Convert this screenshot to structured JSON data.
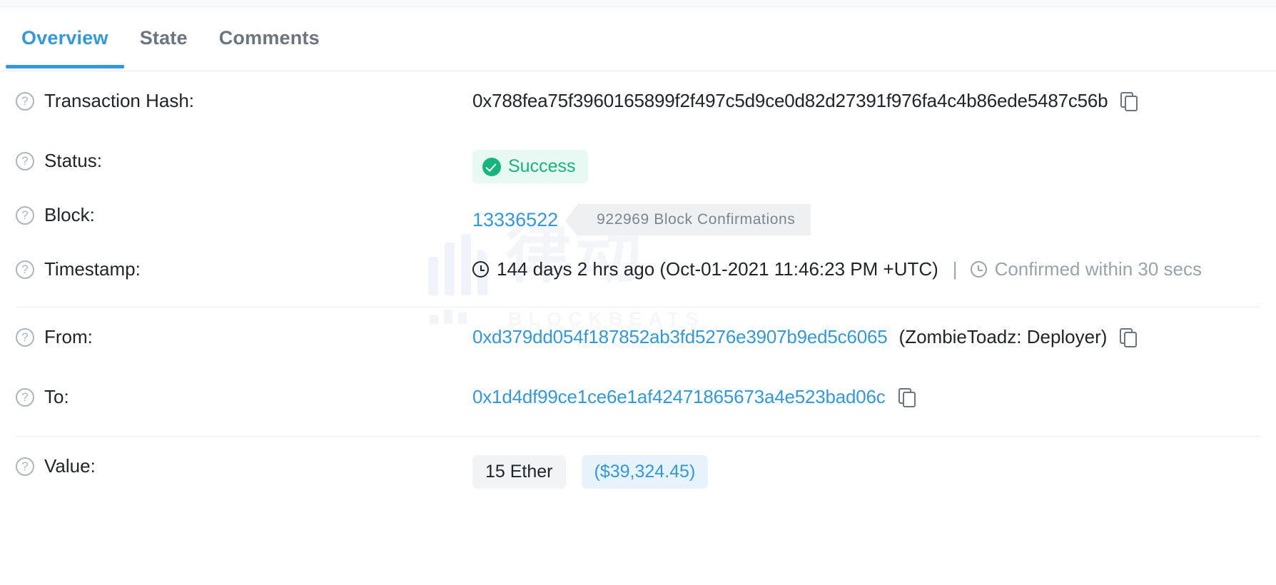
{
  "tabs": [
    {
      "label": "Overview",
      "active": true
    },
    {
      "label": "State",
      "active": false
    },
    {
      "label": "Comments",
      "active": false
    }
  ],
  "watermark": {
    "cjk": "律动",
    "word": "BLOCKBEATS"
  },
  "help_glyph": "?",
  "rows": {
    "transaction_hash": {
      "label": "Transaction Hash:",
      "value": "0x788fea75f3960165899f2f497c5d9ce0d82d27391f976fa4c4b86ede5487c56b"
    },
    "status": {
      "label": "Status:",
      "badge": "Success"
    },
    "block": {
      "label": "Block:",
      "number": "13336522",
      "confirmations": "922969 Block Confirmations"
    },
    "timestamp": {
      "label": "Timestamp:",
      "relative": "144 days 2 hrs ago (Oct-01-2021 11:46:23 PM +UTC)",
      "separator": "|",
      "confirmed_within": "Confirmed within 30 secs"
    },
    "from": {
      "label": "From:",
      "address": "0xd379dd054f187852ab3fd5276e3907b9ed5c6065",
      "tag": "(ZombieToadz: Deployer)"
    },
    "to": {
      "label": "To:",
      "address": "0x1d4df99ce1ce6e1af42471865673a4e523bad06c"
    },
    "value": {
      "label": "Value:",
      "amount": "15 Ether",
      "fiat": "($39,324.45)"
    }
  },
  "colors": {
    "accent_blue": "#3498db",
    "success_green": "#16b47f",
    "success_bg": "#e8f8f3",
    "muted_gray": "#9aa3ab",
    "chip_gray": "#eef0f2",
    "fiat_bg": "#e8f2fb"
  }
}
